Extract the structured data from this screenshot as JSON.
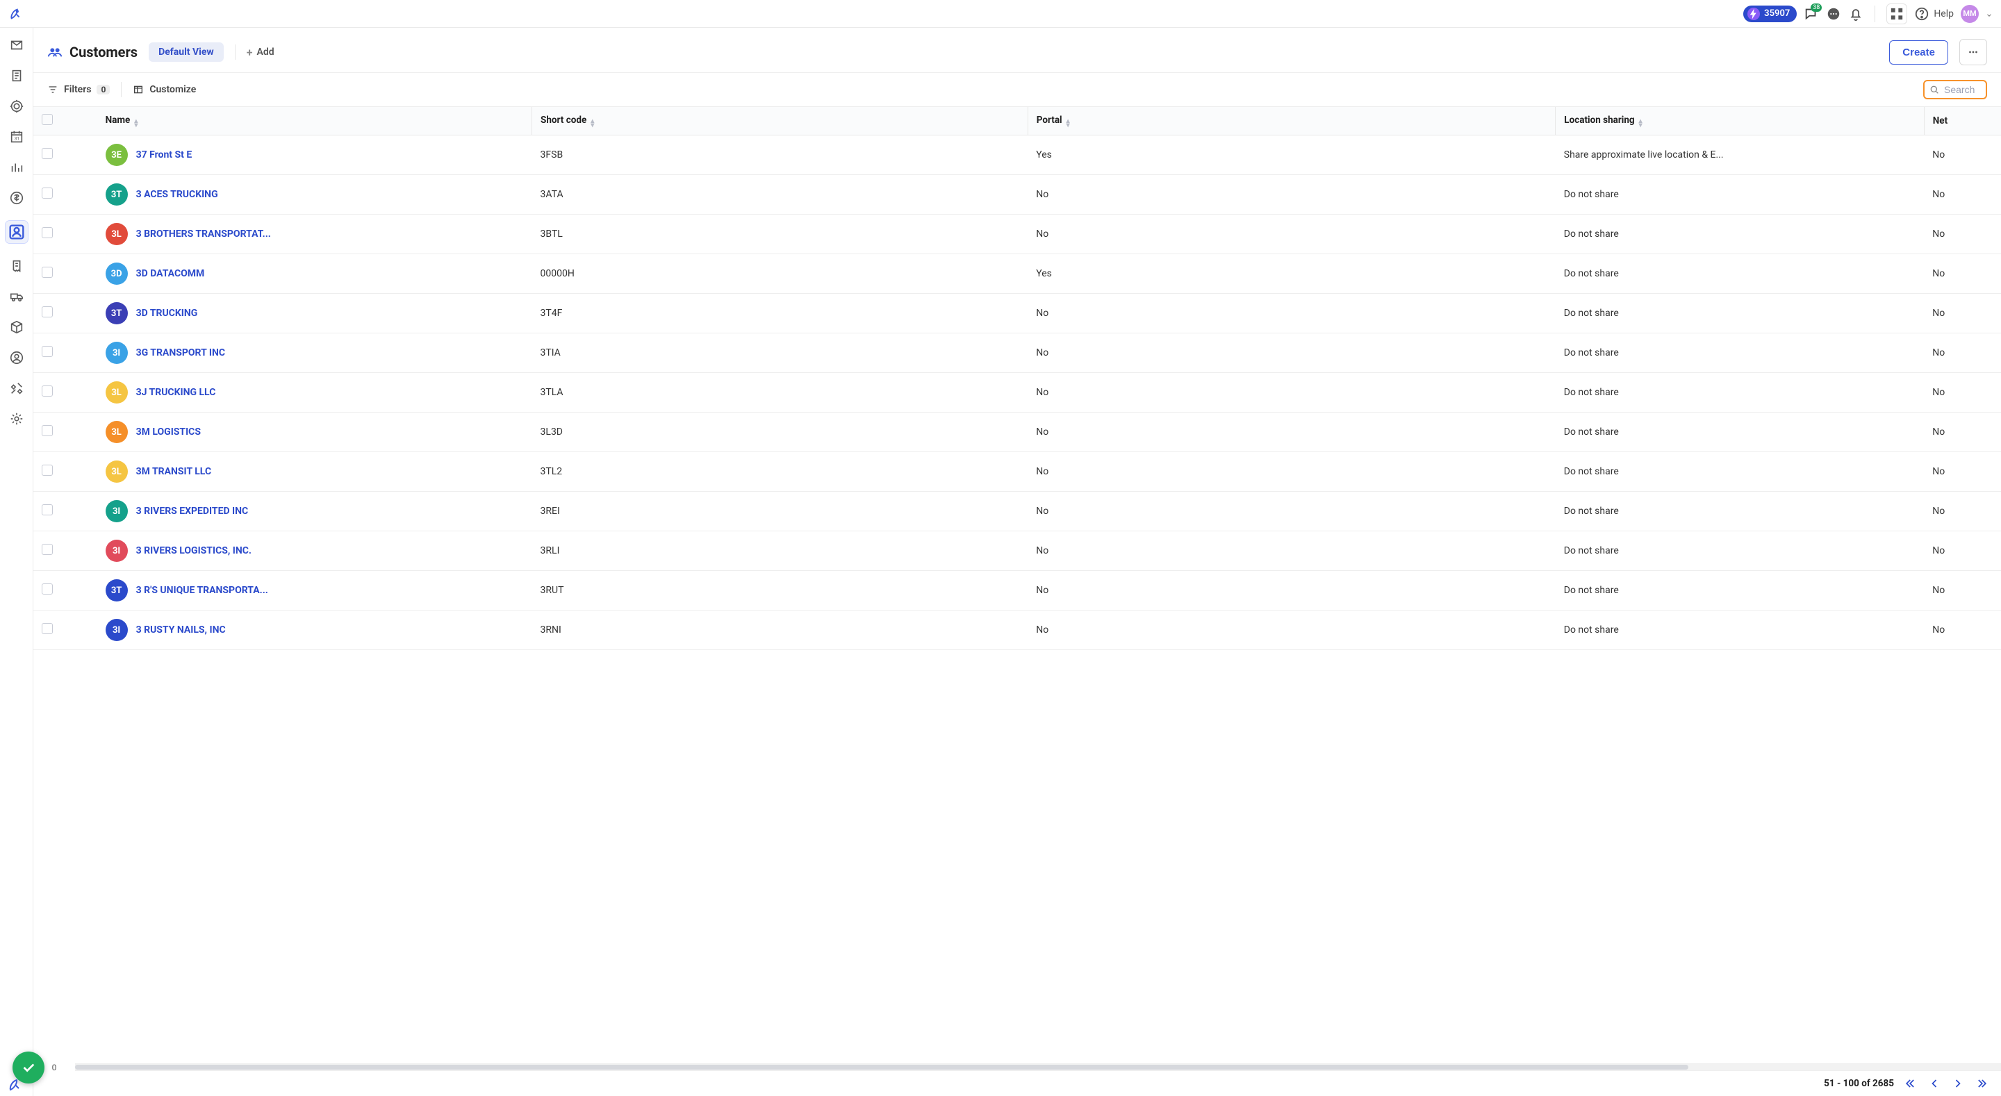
{
  "topbar": {
    "points": "35907",
    "msg_badge": "38",
    "help_label": "Help",
    "avatar_initials": "MM"
  },
  "page": {
    "title": "Customers",
    "view_label": "Default View",
    "add_label": "Add",
    "create_label": "Create"
  },
  "toolbar": {
    "filters_label": "Filters",
    "filters_count": "0",
    "customize_label": "Customize",
    "search_placeholder": "Search"
  },
  "columns": {
    "name": "Name",
    "short_code": "Short code",
    "portal": "Portal",
    "location_sharing": "Location sharing",
    "net": "Net"
  },
  "rows": [
    {
      "av": "3E",
      "av_bg": "#7bbf3f",
      "name": "37 Front St E",
      "short": "3FSB",
      "portal": "Yes",
      "loc": "Share approximate live location & E...",
      "net": "No"
    },
    {
      "av": "3T",
      "av_bg": "#15a18b",
      "name": "3 ACES TRUCKING",
      "short": "3ATA",
      "portal": "No",
      "loc": "Do not share",
      "net": "No"
    },
    {
      "av": "3L",
      "av_bg": "#e14b3b",
      "name": "3 BROTHERS TRANSPORTAT...",
      "short": "3BTL",
      "portal": "No",
      "loc": "Do not share",
      "net": "No"
    },
    {
      "av": "3D",
      "av_bg": "#3aa2e6",
      "name": "3D DATACOMM",
      "short": "00000H",
      "portal": "Yes",
      "loc": "Do not share",
      "net": "No"
    },
    {
      "av": "3T",
      "av_bg": "#3b3fb5",
      "name": "3D TRUCKING",
      "short": "3T4F",
      "portal": "No",
      "loc": "Do not share",
      "net": "No"
    },
    {
      "av": "3I",
      "av_bg": "#3aa2e6",
      "name": "3G TRANSPORT INC",
      "short": "3TIA",
      "portal": "No",
      "loc": "Do not share",
      "net": "No"
    },
    {
      "av": "3L",
      "av_bg": "#f5c542",
      "name": "3J TRUCKING LLC",
      "short": "3TLA",
      "portal": "No",
      "loc": "Do not share",
      "net": "No"
    },
    {
      "av": "3L",
      "av_bg": "#f58f29",
      "name": "3M LOGISTICS",
      "short": "3L3D",
      "portal": "No",
      "loc": "Do not share",
      "net": "No"
    },
    {
      "av": "3L",
      "av_bg": "#f5c542",
      "name": "3M TRANSIT LLC",
      "short": "3TL2",
      "portal": "No",
      "loc": "Do not share",
      "net": "No"
    },
    {
      "av": "3I",
      "av_bg": "#15a18b",
      "name": "3 RIVERS EXPEDITED INC",
      "short": "3REI",
      "portal": "No",
      "loc": "Do not share",
      "net": "No"
    },
    {
      "av": "3I",
      "av_bg": "#e14b5b",
      "name": "3 RIVERS LOGISTICS, INC.",
      "short": "3RLI",
      "portal": "No",
      "loc": "Do not share",
      "net": "No"
    },
    {
      "av": "3T",
      "av_bg": "#2b4acb",
      "name": "3 R'S UNIQUE TRANSPORTA...",
      "short": "3RUT",
      "portal": "No",
      "loc": "Do not share",
      "net": "No"
    },
    {
      "av": "3I",
      "av_bg": "#2b4acb",
      "name": "3 RUSTY NAILS, INC",
      "short": "3RNI",
      "portal": "No",
      "loc": "Do not share",
      "net": "No"
    }
  ],
  "footer": {
    "page_info": "51 - 100 of 2685"
  },
  "hscroll": {
    "corner": "0"
  }
}
